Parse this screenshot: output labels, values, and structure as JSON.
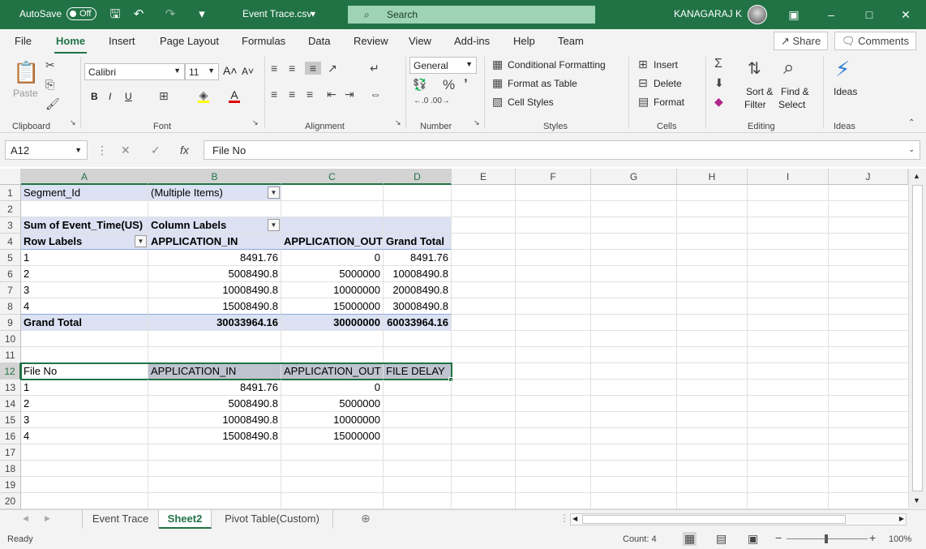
{
  "titlebar": {
    "autosave_label": "AutoSave",
    "autosave_state": "Off",
    "file_name": "Event Trace.csv",
    "search_label": "Search",
    "user_name": "KANAGARAJ K"
  },
  "tabs": [
    "File",
    "Home",
    "Insert",
    "Page Layout",
    "Formulas",
    "Data",
    "Review",
    "View",
    "Add-ins",
    "Help",
    "Team"
  ],
  "active_tab": "Home",
  "share_label": "Share",
  "comments_label": "Comments",
  "ribbon": {
    "clipboard": {
      "label": "Clipboard",
      "paste": "Paste"
    },
    "font": {
      "label": "Font",
      "name": "Calibri",
      "size": "11"
    },
    "alignment": {
      "label": "Alignment"
    },
    "number": {
      "label": "Number",
      "format": "General"
    },
    "styles": {
      "label": "Styles",
      "conditional": "Conditional Formatting",
      "format_table": "Format as Table",
      "cell_styles": "Cell Styles"
    },
    "cells": {
      "label": "Cells",
      "insert": "Insert",
      "delete": "Delete",
      "format": "Format"
    },
    "editing": {
      "label": "Editing",
      "sort1": "Sort &",
      "sort2": "Filter",
      "find1": "Find &",
      "find2": "Select"
    },
    "ideas": {
      "label": "Ideas",
      "button": "Ideas"
    }
  },
  "formula_bar": {
    "name_box": "A12",
    "content": "File No"
  },
  "columns": [
    "A",
    "B",
    "C",
    "D",
    "E",
    "F",
    "G",
    "H",
    "I",
    "J"
  ],
  "rows": [
    "1",
    "2",
    "3",
    "4",
    "5",
    "6",
    "7",
    "8",
    "9",
    "10",
    "11",
    "12",
    "13",
    "14",
    "15",
    "16",
    "17",
    "18",
    "19",
    "20"
  ],
  "cells": {
    "r1": {
      "a": "Segment_Id",
      "b": "(Multiple Items)"
    },
    "r3": {
      "a": "Sum of Event_Time(US)",
      "b": "Column Labels"
    },
    "r4": {
      "a": "Row Labels",
      "b": "APPLICATION_IN",
      "c": "APPLICATION_OUT",
      "d": "Grand Total"
    },
    "r5": {
      "a": "1",
      "b": "8491.76",
      "c": "0",
      "d": "8491.76"
    },
    "r6": {
      "a": "2",
      "b": "5008490.8",
      "c": "5000000",
      "d": "10008490.8"
    },
    "r7": {
      "a": "3",
      "b": "10008490.8",
      "c": "10000000",
      "d": "20008490.8"
    },
    "r8": {
      "a": "4",
      "b": "15008490.8",
      "c": "15000000",
      "d": "30008490.8"
    },
    "r9": {
      "a": "Grand Total",
      "b": "30033964.16",
      "c": "30000000",
      "d": "60033964.16"
    },
    "r12": {
      "a": "File No",
      "b": "APPLICATION_IN",
      "c": "APPLICATION_OUT",
      "d": "FILE DELAY"
    },
    "r13": {
      "a": "1",
      "b": "8491.76",
      "c": "0"
    },
    "r14": {
      "a": "2",
      "b": "5008490.8",
      "c": "5000000"
    },
    "r15": {
      "a": "3",
      "b": "10008490.8",
      "c": "10000000"
    },
    "r16": {
      "a": "4",
      "b": "15008490.8",
      "c": "15000000"
    }
  },
  "sheets": [
    "Event Trace",
    "Sheet2",
    "Pivot Table(Custom)"
  ],
  "active_sheet": "Sheet2",
  "status": {
    "ready": "Ready",
    "count": "Count: 4",
    "zoom": "100%"
  },
  "colors": {
    "accent": "#217346",
    "pivot": "#dce1f3",
    "highlight": "#bfc3cf"
  }
}
